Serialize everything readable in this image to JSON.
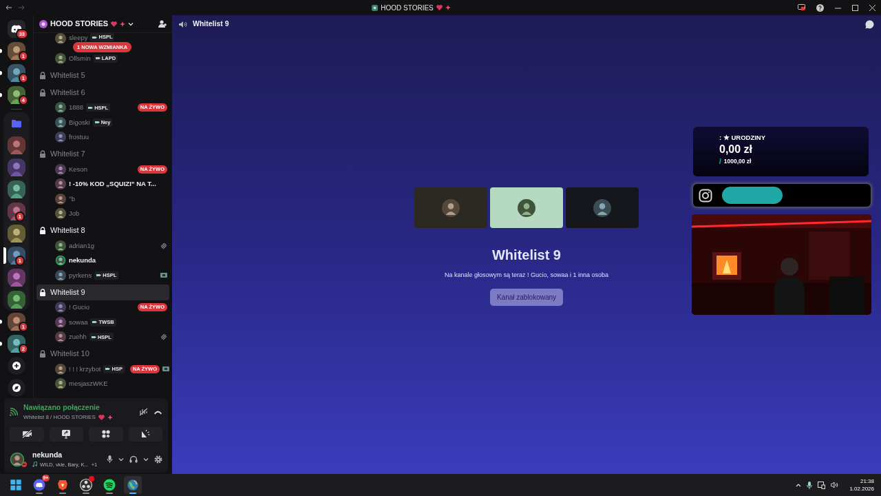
{
  "window": {
    "title": "HOOD STORIES"
  },
  "servers": [
    {
      "kind": "home",
      "badge": "33",
      "unread": false,
      "selected": false
    },
    {
      "kind": "picture",
      "badge": "1",
      "unread": true,
      "selected": false
    },
    {
      "kind": "picture",
      "badge": "1",
      "unread": true,
      "selected": false
    },
    {
      "kind": "picture",
      "badge": "4",
      "unread": true,
      "selected": false
    },
    {
      "kind": "folder",
      "children": [
        {
          "kind": "picture",
          "unread": false,
          "selected": false
        },
        {
          "kind": "picture",
          "unread": false,
          "selected": false
        },
        {
          "kind": "picture",
          "unread": false,
          "selected": false
        },
        {
          "kind": "picture",
          "badge": "1",
          "unread": false,
          "selected": false
        },
        {
          "kind": "picture",
          "unread": false,
          "selected": false
        },
        {
          "kind": "picture",
          "badge": "1",
          "unread": false,
          "selected": true
        },
        {
          "kind": "picture",
          "unread": false,
          "selected": false
        },
        {
          "kind": "picture",
          "unread": false,
          "selected": false
        }
      ]
    },
    {
      "kind": "picture",
      "badge": "1",
      "unread": true,
      "selected": false
    },
    {
      "kind": "picture",
      "badge": "2",
      "unread": true,
      "selected": false
    },
    {
      "kind": "add",
      "unread": false,
      "selected": false
    },
    {
      "kind": "discover",
      "unread": false,
      "selected": false
    }
  ],
  "guild": {
    "name": "HOOD STORIES"
  },
  "mention_pill": "1 NOWA WZMIANKA",
  "scrolled_users": [
    {
      "name": "sleepy",
      "tag": "HSPL",
      "bright": false,
      "muted": false,
      "streaming": false,
      "speaking": false
    },
    {
      "name": "Ollsmin",
      "tag": "LAPD",
      "bright": false,
      "muted": false,
      "streaming": false,
      "speaking": false
    }
  ],
  "channels": [
    {
      "name": "Whitelist 5",
      "active": false,
      "selected": false
    },
    {
      "name": "Whitelist 6",
      "active": false,
      "selected": false,
      "users": [
        {
          "name": "1888",
          "tag": "HSPL",
          "badge": "NA ŻYWO",
          "bright": false,
          "muted": false,
          "streaming": false,
          "speaking": false
        },
        {
          "name": "Bigoski",
          "tag": "Ney",
          "bright": false,
          "muted": false,
          "streaming": false,
          "speaking": false
        },
        {
          "name": "frostuu",
          "bright": false,
          "muted": false,
          "streaming": false,
          "speaking": false
        }
      ]
    },
    {
      "name": "Whitelist 7",
      "active": false,
      "selected": false,
      "users": [
        {
          "name": "Keson",
          "badge": "NA ŻYWO",
          "bright": false,
          "muted": false,
          "streaming": false,
          "speaking": false
        },
        {
          "name": "! -10% KOD „SQUIZI” NA T...",
          "bright": true,
          "muted": false,
          "streaming": false,
          "speaking": false
        },
        {
          "name": "°b",
          "bright": false,
          "muted": false,
          "streaming": false,
          "speaking": false
        },
        {
          "name": "Job",
          "bright": false,
          "muted": false,
          "streaming": false,
          "speaking": false
        }
      ]
    },
    {
      "name": "Whitelist 8",
      "active": true,
      "selected": false,
      "users": [
        {
          "name": "adrian1g",
          "bright": false,
          "muted": true,
          "streaming": false,
          "speaking": false
        },
        {
          "name": "nekunda",
          "bright": true,
          "muted": false,
          "streaming": false,
          "speaking": true
        },
        {
          "name": "pyrkens",
          "tag": "HSPL",
          "bright": false,
          "muted": false,
          "streaming": true,
          "speaking": false
        }
      ]
    },
    {
      "name": "Whitelist 9",
      "active": true,
      "selected": true,
      "users": [
        {
          "name": "! Gucio",
          "badge": "NA ŻYWO",
          "bright": false,
          "muted": false,
          "streaming": false,
          "speaking": false
        },
        {
          "name": "sowaa",
          "tag": "TWSB",
          "bright": false,
          "muted": false,
          "streaming": false,
          "speaking": false
        },
        {
          "name": "zuehh",
          "tag": "HSPL",
          "bright": false,
          "muted": true,
          "streaming": false,
          "speaking": false
        }
      ]
    },
    {
      "name": "Whitelist 10",
      "active": false,
      "selected": false,
      "users": [
        {
          "name": "! ! ! krzybot",
          "tag": "HSP",
          "badge": "NA ŻYWO",
          "bright": false,
          "muted": false,
          "streaming": true,
          "speaking": false
        },
        {
          "name": "mesjaszWKE",
          "bright": false,
          "muted": false,
          "streaming": false,
          "speaking": false
        }
      ]
    }
  ],
  "voice_panel": {
    "status": "Nawiązano połączenie",
    "location": "Whitelist 8 / HOOD STORIES"
  },
  "user_panel": {
    "name": "nekunda",
    "activity": "WILD, vkie, Bary, K...",
    "extra": "+1"
  },
  "main": {
    "header": "Whitelist 9",
    "tiles": [
      {
        "color": "#2b2922"
      },
      {
        "color": "#b6d9c2"
      },
      {
        "color": "#15171d"
      }
    ],
    "title": "Whitelist 9",
    "subtitle": "Na kanale głosowym są teraz ! Gucio, sowaa i 1 inna osoba",
    "button": {
      "label": "Kanał zablokowany",
      "disabled": true
    }
  },
  "overlay": {
    "goal_title": ": ★ URODZINY",
    "amount": "0,00 zł",
    "separator": "/",
    "target": "1000,00 zł"
  },
  "taskbar": {
    "apps": [
      {
        "kind": "windows",
        "active": false,
        "alert": false
      },
      {
        "kind": "discord",
        "badge": "9+",
        "active": false,
        "alert": false
      },
      {
        "kind": "brave",
        "active": false,
        "alert": false
      },
      {
        "kind": "obs",
        "active": false,
        "alert": true
      },
      {
        "kind": "spotify",
        "active": false,
        "alert": false
      },
      {
        "kind": "globe",
        "active": true,
        "alert": false
      }
    ],
    "time": "21:38",
    "date": "1.02.2026"
  }
}
